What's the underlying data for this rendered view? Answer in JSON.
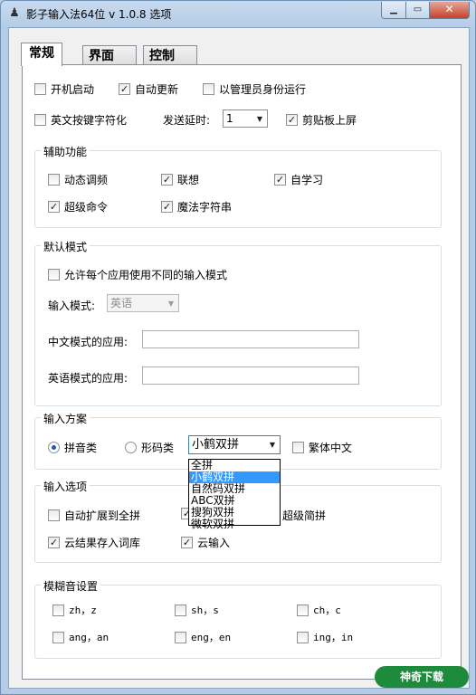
{
  "window": {
    "title": "影子输入法64位 v 1.0.8 选项"
  },
  "tabs": [
    "常规",
    "界面",
    "控制"
  ],
  "general": {
    "startup": {
      "label": "开机启动",
      "checked": false
    },
    "auto_update": {
      "label": "自动更新",
      "checked": true
    },
    "run_as_admin": {
      "label": "以管理员身份运行",
      "checked": false
    },
    "english_key_char": {
      "label": "英文按键字符化",
      "checked": false
    },
    "send_delay_label": "发送延时:",
    "send_delay_value": "1",
    "clipboard_screen": {
      "label": "剪贴板上屏",
      "checked": true
    }
  },
  "assist": {
    "title": "辅助功能",
    "items": [
      {
        "label": "动态调频",
        "checked": false
      },
      {
        "label": "联想",
        "checked": true
      },
      {
        "label": "自学习",
        "checked": true
      },
      {
        "label": "超级命令",
        "checked": true
      },
      {
        "label": "魔法字符串",
        "checked": true
      }
    ]
  },
  "default_mode": {
    "title": "默认模式",
    "per_app": {
      "label": "允许每个应用使用不同的输入模式",
      "checked": false
    },
    "input_mode_label": "输入模式:",
    "input_mode_value": "英语",
    "chinese_apps_label": "中文模式的应用:",
    "english_apps_label": "英语模式的应用:"
  },
  "scheme": {
    "title": "输入方案",
    "pinyin": {
      "label": "拼音类",
      "selected": true
    },
    "shape": {
      "label": "形码类",
      "selected": false
    },
    "scheme_value": "小鹤双拼",
    "traditional": {
      "label": "繁体中文",
      "checked": false
    },
    "options": [
      "全拼",
      "小鹤双拼",
      "自然码双拼",
      "ABC双拼",
      "搜狗双拼",
      "微软双拼"
    ],
    "selected_option": "小鹤双拼"
  },
  "input_options": {
    "title": "输入选项",
    "auto_expand": {
      "label": "自动扩展到全拼",
      "checked": false
    },
    "hidden_cb": {
      "checked": true
    },
    "super_jianpin": {
      "label": "超级简拼"
    },
    "cloud_save": {
      "label": "云结果存入词库",
      "checked": true
    },
    "cloud_input": {
      "label": "云输入",
      "checked": true
    }
  },
  "fuzzy": {
    "title": "模糊音设置",
    "items": [
      {
        "label": "zh，z",
        "checked": false
      },
      {
        "label": "sh，s",
        "checked": false
      },
      {
        "label": "ch，c",
        "checked": false
      },
      {
        "label": "ang，an",
        "checked": false
      },
      {
        "label": "eng，en",
        "checked": false
      },
      {
        "label": "ing，in",
        "checked": false
      }
    ]
  },
  "watermark": "神奇下载",
  "check_glyph": "✓",
  "icons": {
    "app": "shadow-app-icon",
    "minimize": "minimize-icon",
    "maximize": "maximize-icon",
    "close": "close-icon",
    "dropdown": "chevron-down-icon"
  }
}
